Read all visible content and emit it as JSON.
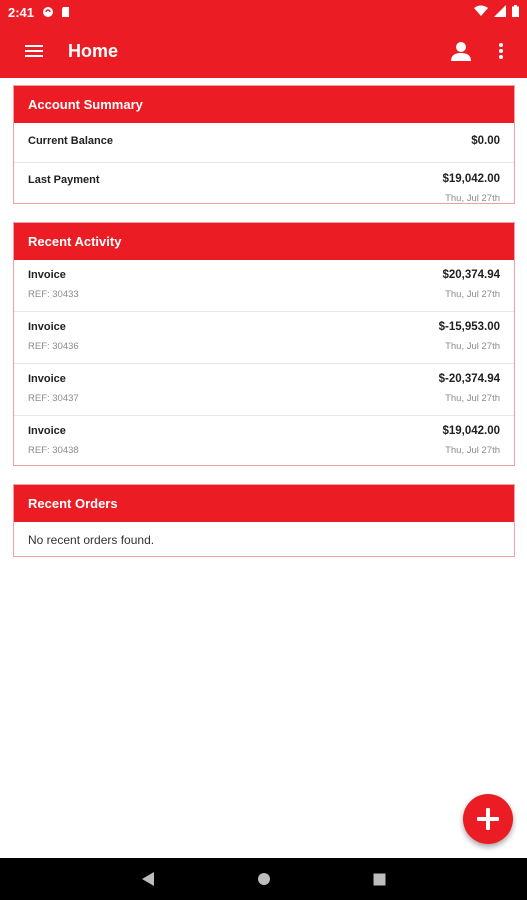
{
  "status_bar": {
    "time": "2:41"
  },
  "app_bar": {
    "title": "Home"
  },
  "account_summary": {
    "title": "Account Summary",
    "current_balance_label": "Current Balance",
    "current_balance_value": "$0.00",
    "last_payment_label": "Last Payment",
    "last_payment_value": "$19,042.00",
    "last_payment_date": "Thu, Jul 27th"
  },
  "recent_activity": {
    "title": "Recent Activity",
    "items": [
      {
        "type": "Invoice",
        "ref": "REF: 30433",
        "amount": "$20,374.94",
        "date": "Thu, Jul 27th"
      },
      {
        "type": "Invoice",
        "ref": "REF: 30436",
        "amount": "$-15,953.00",
        "date": "Thu, Jul 27th"
      },
      {
        "type": "Invoice",
        "ref": "REF: 30437",
        "amount": "$-20,374.94",
        "date": "Thu, Jul 27th"
      },
      {
        "type": "Invoice",
        "ref": "REF: 30438",
        "amount": "$19,042.00",
        "date": "Thu, Jul 27th"
      }
    ]
  },
  "recent_orders": {
    "title": "Recent Orders",
    "empty_message": "No recent orders found."
  },
  "icons": {
    "menu": "menu-icon",
    "account": "account-icon",
    "more": "more-vert-icon",
    "fab": "plus-icon",
    "nav": [
      "back-icon",
      "home-icon",
      "recents-icon"
    ]
  },
  "colors": {
    "primary": "#ec1c24",
    "card_border": "#f0a0a3",
    "secondary_text": "#8a8a8a"
  }
}
